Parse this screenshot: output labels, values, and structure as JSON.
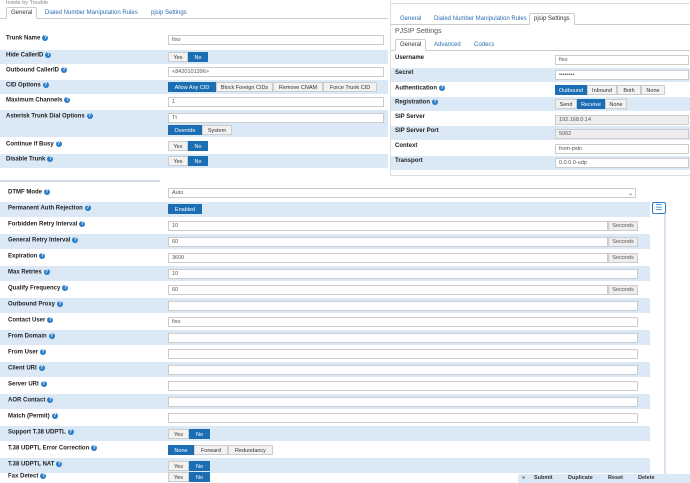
{
  "top_strip_text": "Inside by Trouble",
  "left_panel": {
    "tabs": [
      "General",
      "Dialed Number Manipulation Rules",
      "pjsip Settings"
    ],
    "fields": {
      "trunk_name": {
        "label": "Trunk Name",
        "value": "fixo"
      },
      "hide_callerid": {
        "label": "Hide CallerID",
        "yes": "Yes",
        "no": "No"
      },
      "outbound_callerid": {
        "label": "Outbound CallerID",
        "value": "<8420101396>"
      },
      "cid_options": {
        "label": "CID Options",
        "options": [
          "Allow Any CID",
          "Block Foreign CIDs",
          "Remove CNAM",
          "Force Trunk CID"
        ]
      },
      "maximum_channels": {
        "label": "Maximum Channels",
        "value": "1"
      },
      "dial_options": {
        "label": "Asterisk Trunk Dial Options",
        "value": "Tt",
        "toggle": [
          "Override",
          "System"
        ]
      },
      "continue_if_busy": {
        "label": "Continue if Busy",
        "yes": "Yes",
        "no": "No"
      },
      "disable_trunk": {
        "label": "Disable Trunk",
        "yes": "Yes",
        "no": "No"
      }
    }
  },
  "right_panel": {
    "tabs": [
      "General",
      "Dialed Number Manipulation Rules",
      "pjsip Settings"
    ],
    "heading": "PJSIP Settings",
    "subtabs": [
      "General",
      "Advanced",
      "Codecs"
    ],
    "fields": {
      "username": {
        "label": "Username",
        "value": "fixo"
      },
      "secret": {
        "label": "Secret",
        "value": "••••••••"
      },
      "authentication": {
        "label": "Authentication",
        "options": [
          "Outbound",
          "Inbound",
          "Both",
          "None"
        ]
      },
      "registration": {
        "label": "Registration",
        "options": [
          "Send",
          "Receive",
          "None"
        ]
      },
      "sip_server": {
        "label": "SIP Server",
        "value": "192.168.0.14"
      },
      "sip_server_port": {
        "label": "SIP Server Port",
        "value": "5062"
      },
      "context": {
        "label": "Context",
        "value": "from-pstn"
      },
      "transport": {
        "label": "Transport",
        "value": "0.0.0.0-udp"
      }
    }
  },
  "bottom_panel": {
    "dtmf_mode": {
      "label": "DTMF Mode",
      "value": "Auto"
    },
    "permanent_auth_rejection": {
      "label": "Permanent Auth Rejection",
      "value": "Enabled"
    },
    "forbidden_retry_interval": {
      "label": "Forbidden Retry Interval",
      "value": "10",
      "unit": "Seconds"
    },
    "general_retry_interval": {
      "label": "General Retry Interval",
      "value": "60",
      "unit": "Seconds"
    },
    "expiration": {
      "label": "Expiration",
      "value": "3600",
      "unit": "Seconds"
    },
    "max_retries": {
      "label": "Max Retries",
      "value": "10"
    },
    "qualify_frequency": {
      "label": "Qualify Frequency",
      "value": "60",
      "unit": "Seconds"
    },
    "outbound_proxy": {
      "label": "Outbound Proxy",
      "value": ""
    },
    "contact_user": {
      "label": "Contact User",
      "value": "fixo"
    },
    "from_domain": {
      "label": "From Domain",
      "value": ""
    },
    "from_user": {
      "label": "From User",
      "value": ""
    },
    "client_uri": {
      "label": "Client URI",
      "value": ""
    },
    "server_uri": {
      "label": "Server URI",
      "value": ""
    },
    "aor_contact": {
      "label": "AOR Contact",
      "value": ""
    },
    "match_permit": {
      "label": "Match (Permit)",
      "value": ""
    },
    "support_t38": {
      "label": "Support T.38 UDPTL",
      "yes": "Yes",
      "no": "No"
    },
    "t38_error_correction": {
      "label": "T.38 UDPTL Error Correction",
      "options": [
        "None",
        "Forward",
        "Redundancy"
      ]
    },
    "t38_nat": {
      "label": "T.38 UDPTL NAT",
      "yes": "Yes",
      "no": "No"
    },
    "fax_detect": {
      "label": "Fax Detect",
      "yes": "Yes",
      "no": "No"
    }
  },
  "action_bar": {
    "toggle": "»",
    "submit": "Submit",
    "duplicate": "Duplicate",
    "reset": "Reset",
    "delete": "Delete"
  },
  "help_glyph": "?"
}
